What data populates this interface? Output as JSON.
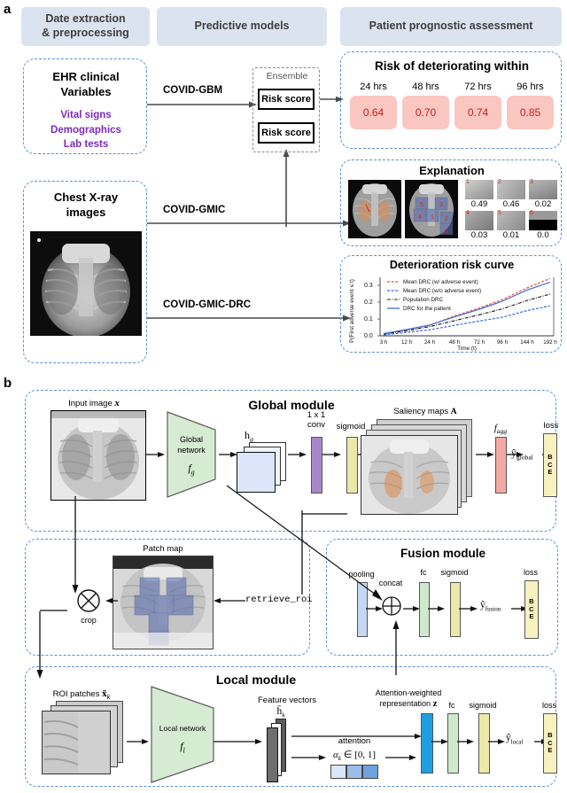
{
  "panels": {
    "a": "a",
    "b": "b"
  },
  "headers": [
    {
      "label": "Date extraction\n& preprocessing",
      "line1": "Date extraction",
      "line2": "& preprocessing"
    },
    {
      "label": "Predictive models",
      "line1": "Predictive models",
      "line2": ""
    },
    {
      "label": "Patient prognostic assessment",
      "line1": "Patient prognostic assessment",
      "line2": ""
    }
  ],
  "inputs": {
    "ehr": {
      "title_line1": "EHR clinical",
      "title_line2": "Variables",
      "items": [
        "Vital signs",
        "Demographics",
        "Lab tests"
      ]
    },
    "cxr": {
      "title_line1": "Chest X-ray",
      "title_line2": "images"
    }
  },
  "models": {
    "gbm": "COVID-GBM",
    "gmic": "COVID-GMIC",
    "gmic_drc": "COVID-GMIC-DRC",
    "ensemble_label": "Ensemble",
    "risk_score_1": "Risk score",
    "risk_score_2": "Risk score"
  },
  "risk": {
    "title": "Risk of deteriorating within",
    "columns": [
      {
        "hours": "24 hrs",
        "value": "0.64"
      },
      {
        "hours": "48 hrs",
        "value": "0.70"
      },
      {
        "hours": "72 hrs",
        "value": "0.74"
      },
      {
        "hours": "96 hrs",
        "value": "0.85"
      }
    ],
    "cell_bg": "#fac6c0",
    "cell_text": "#c0221c"
  },
  "explanation": {
    "title": "Explanation",
    "patch_scores": [
      "0.49",
      "0.46",
      "0.02",
      "0.03",
      "0.01",
      "0.0"
    ],
    "patch_indices": [
      "1",
      "2",
      "3",
      "4",
      "5",
      "6"
    ],
    "roi_labels": [
      "5",
      "3",
      "4",
      "1",
      "2",
      "6"
    ]
  },
  "chart_data": {
    "type": "line",
    "title": "Deterioration risk curve",
    "xlabel": "Time (t)",
    "ylabel": "P(First adverse event ≤ t)",
    "x": [
      "3 h",
      "12 h",
      "24 h",
      "48 h",
      "72 h",
      "96 h",
      "144 h",
      "192 h"
    ],
    "yticks": [
      "0.0",
      "0.1",
      "0.2",
      "0.3"
    ],
    "ylim": [
      0.0,
      0.36
    ],
    "grid": false,
    "legend_position": "upper-left",
    "series": [
      {
        "name": "Mean DRC (w/ adverse event)",
        "color": "#e8524a",
        "style": "dashed",
        "values": [
          0.012,
          0.035,
          0.062,
          0.118,
          0.165,
          0.215,
          0.285,
          0.34
        ]
      },
      {
        "name": "Mean DRC (w/o adverse event)",
        "color": "#4169d8",
        "style": "dashed",
        "values": [
          0.006,
          0.02,
          0.036,
          0.062,
          0.088,
          0.11,
          0.15,
          0.178
        ]
      },
      {
        "name": "Population DRC",
        "color": "#1a1a1a",
        "style": "dashdot",
        "values": [
          0.01,
          0.03,
          0.055,
          0.09,
          0.125,
          0.16,
          0.21,
          0.248
        ]
      },
      {
        "name": "DRC for the patient",
        "color": "#3f6fd6",
        "style": "solid",
        "values": [
          0.013,
          0.038,
          0.064,
          0.112,
          0.158,
          0.205,
          0.272,
          0.318
        ]
      }
    ]
  },
  "global_module": {
    "title": "Global module",
    "input_label": "Input image",
    "input_symbol": "x",
    "network_line1": "Global",
    "network_line2": "network",
    "network_symbol": "f",
    "network_sub": "g",
    "feature_label": "h",
    "feature_sub": "g",
    "conv_line1": "1 x 1",
    "conv_line2": "conv",
    "sigmoid": "sigmoid",
    "saliency_label": "Saliency maps",
    "saliency_symbol": "A",
    "fagg": "f",
    "fagg_sub": "agg",
    "yhat": "ŷ",
    "yhat_sub": "global",
    "loss": "loss",
    "loss_letters": [
      "B",
      "C",
      "E"
    ]
  },
  "patch_section": {
    "patch_map_label": "Patch map",
    "retrieve_roi": "retrieve_roi",
    "crop": "crop"
  },
  "fusion_module": {
    "title": "Fusion module",
    "pooling": "pooling",
    "concat": "concat",
    "fc": "fc",
    "sigmoid": "sigmoid",
    "yhat": "ŷ",
    "yhat_sub": "fusion",
    "loss": "loss",
    "loss_letters": [
      "B",
      "C",
      "E"
    ]
  },
  "local_module": {
    "title": "Local module",
    "roi_label": "ROI patches",
    "roi_symbol": "x̃",
    "roi_sub": "k",
    "network_line1": "Local network",
    "network_symbol": "f",
    "network_sub": "l",
    "feature_label": "Feature vectors",
    "feature_symbol": "h̄",
    "feature_sub": "k",
    "attn_label": "attention",
    "attn_formula": "α",
    "attn_sub": "k",
    "attn_range": "∈ [0, 1]",
    "attn_weighted_line1": "Attention-weighted",
    "attn_weighted_line2": "representation",
    "z_symbol": "z",
    "fc": "fc",
    "sigmoid": "sigmoid",
    "yhat": "ŷ",
    "yhat_sub": "local",
    "loss": "loss",
    "loss_letters": [
      "B",
      "C",
      "E"
    ]
  },
  "colors": {
    "banner": "#dce3f0",
    "dash_blue": "#5b8fd4",
    "purple": "#7b2bbd",
    "trap_green": "#d6ecd2",
    "conv_purple": "#a688c8",
    "sigmoid_yellow": "#ece8a8",
    "fagg_red": "#f3a9a2",
    "pooling_blue": "#c5d8f2",
    "fc_green": "#cfe9cc",
    "z_blue": "#1f9fe0",
    "loss_yellow": "#f7f3c0"
  }
}
